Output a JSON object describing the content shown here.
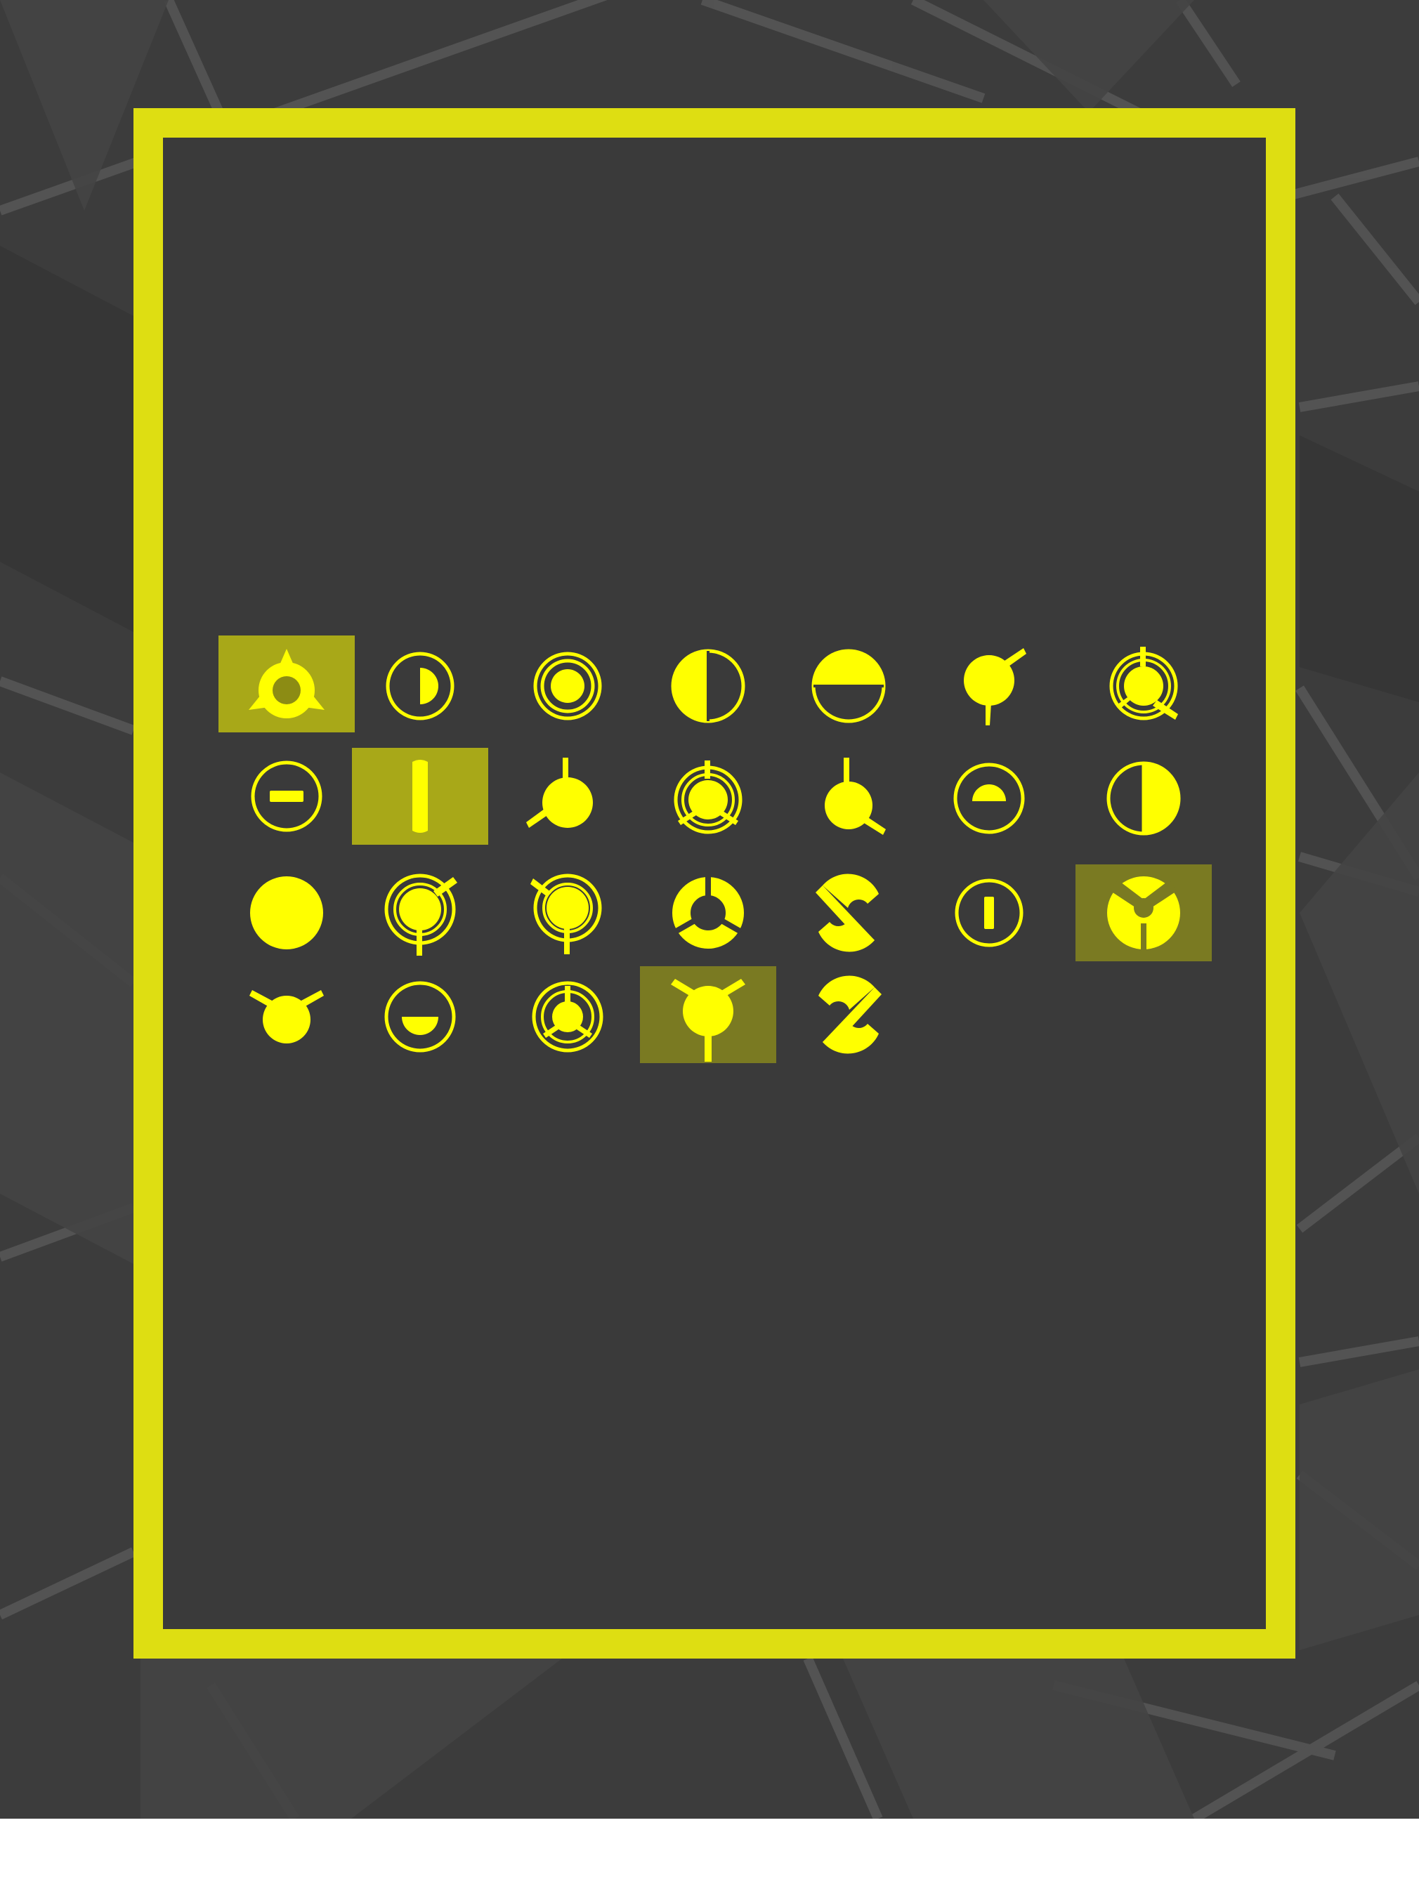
{
  "colors": {
    "background": "#3c3c3c",
    "board": "#3a3a3a",
    "frame": "#dede12",
    "glyph": "#ffff00",
    "highlight": "#a8a818",
    "highlight_dim": "#7a7a22"
  },
  "grid": {
    "columns": 7,
    "rows": 4,
    "cells": [
      {
        "row": 0,
        "col": 0,
        "glyph": "ring-three-spikes-icon",
        "highlighted": true,
        "shade": "highlight"
      },
      {
        "row": 0,
        "col": 1,
        "glyph": "ring-half-dot-icon",
        "highlighted": false
      },
      {
        "row": 0,
        "col": 2,
        "glyph": "ring-dot-icon",
        "highlighted": false
      },
      {
        "row": 0,
        "col": 3,
        "glyph": "half-moon-vertical-icon",
        "highlighted": false
      },
      {
        "row": 0,
        "col": 4,
        "glyph": "half-moon-horizontal-icon",
        "highlighted": false
      },
      {
        "row": 0,
        "col": 5,
        "glyph": "dot-two-spokes-icon",
        "highlighted": false
      },
      {
        "row": 0,
        "col": 6,
        "glyph": "ring-dot-three-spokes-icon",
        "highlighted": false
      },
      {
        "row": 1,
        "col": 0,
        "glyph": "ring-bar-horizontal-icon",
        "highlighted": false
      },
      {
        "row": 1,
        "col": 1,
        "glyph": "bar-vertical-icon",
        "highlighted": true,
        "shade": "highlight"
      },
      {
        "row": 1,
        "col": 2,
        "glyph": "dot-three-spokes-a-icon",
        "highlighted": false
      },
      {
        "row": 1,
        "col": 3,
        "glyph": "ring-dot-cross-spokes-icon",
        "highlighted": false
      },
      {
        "row": 1,
        "col": 4,
        "glyph": "dot-three-spokes-b-icon",
        "highlighted": false
      },
      {
        "row": 1,
        "col": 5,
        "glyph": "ring-half-cap-icon",
        "highlighted": false
      },
      {
        "row": 1,
        "col": 6,
        "glyph": "ring-half-right-icon",
        "highlighted": false
      },
      {
        "row": 2,
        "col": 0,
        "glyph": "solid-disc-icon",
        "highlighted": false
      },
      {
        "row": 2,
        "col": 1,
        "glyph": "ring-dot-two-spokes-icon",
        "highlighted": false
      },
      {
        "row": 2,
        "col": 2,
        "glyph": "ring-dot-two-spokes-b-icon",
        "highlighted": false
      },
      {
        "row": 2,
        "col": 3,
        "glyph": "segmented-ring-icon",
        "highlighted": false
      },
      {
        "row": 2,
        "col": 4,
        "glyph": "s-swirl-icon",
        "highlighted": false
      },
      {
        "row": 2,
        "col": 5,
        "glyph": "ring-bar-vertical-icon",
        "highlighted": false
      },
      {
        "row": 2,
        "col": 6,
        "glyph": "notched-disc-icon",
        "highlighted": true,
        "shade": "highlight_dim"
      },
      {
        "row": 3,
        "col": 0,
        "glyph": "dot-horns-icon",
        "highlighted": false
      },
      {
        "row": 3,
        "col": 1,
        "glyph": "ring-half-bottom-icon",
        "highlighted": false
      },
      {
        "row": 3,
        "col": 2,
        "glyph": "ring-dot-triple-spokes-icon",
        "highlighted": false
      },
      {
        "row": 3,
        "col": 3,
        "glyph": "dot-y-spokes-icon",
        "highlighted": true,
        "shade": "highlight_dim"
      },
      {
        "row": 3,
        "col": 4,
        "glyph": "z-swirl-icon",
        "highlighted": false
      }
    ]
  }
}
